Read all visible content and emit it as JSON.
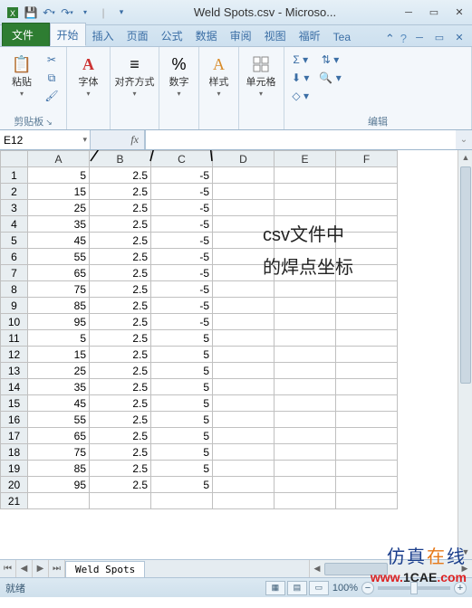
{
  "titlebar": {
    "title": "Weld Spots.csv - Microso..."
  },
  "tabs": {
    "file": "文件",
    "home": "开始",
    "insert": "插入",
    "page": "页面",
    "formula": "公式",
    "data": "数据",
    "review": "审阅",
    "view": "视图",
    "foxit": "福昕",
    "team": "Tea"
  },
  "ribbon": {
    "paste": "粘贴",
    "font": "字体",
    "align": "对齐方式",
    "number": "数字",
    "styles": "样式",
    "cells": "单元格",
    "clipboard_grp": "剪贴板",
    "editing_grp": "编辑"
  },
  "formula_bar": {
    "name_box": "E12",
    "fx": "fx",
    "formula": ""
  },
  "annotations": {
    "x": "X",
    "y": "Y",
    "z": "Z",
    "note_line1": "csv文件中",
    "note_line2": "的焊点坐标"
  },
  "columns": [
    "A",
    "B",
    "C",
    "D",
    "E",
    "F"
  ],
  "rows_header": [
    "1",
    "2",
    "3",
    "4",
    "5",
    "6",
    "7",
    "8",
    "9",
    "10",
    "11",
    "12",
    "13",
    "14",
    "15",
    "16",
    "17",
    "18",
    "19",
    "20",
    "21"
  ],
  "chart_data": {
    "type": "table",
    "columns": [
      "A",
      "B",
      "C"
    ],
    "rows": [
      [
        "5",
        "2.5",
        "-5"
      ],
      [
        "15",
        "2.5",
        "-5"
      ],
      [
        "25",
        "2.5",
        "-5"
      ],
      [
        "35",
        "2.5",
        "-5"
      ],
      [
        "45",
        "2.5",
        "-5"
      ],
      [
        "55",
        "2.5",
        "-5"
      ],
      [
        "65",
        "2.5",
        "-5"
      ],
      [
        "75",
        "2.5",
        "-5"
      ],
      [
        "85",
        "2.5",
        "-5"
      ],
      [
        "95",
        "2.5",
        "-5"
      ],
      [
        "5",
        "2.5",
        "5"
      ],
      [
        "15",
        "2.5",
        "5"
      ],
      [
        "25",
        "2.5",
        "5"
      ],
      [
        "35",
        "2.5",
        "5"
      ],
      [
        "45",
        "2.5",
        "5"
      ],
      [
        "55",
        "2.5",
        "5"
      ],
      [
        "65",
        "2.5",
        "5"
      ],
      [
        "75",
        "2.5",
        "5"
      ],
      [
        "85",
        "2.5",
        "5"
      ],
      [
        "95",
        "2.5",
        "5"
      ],
      [
        "",
        "",
        ""
      ]
    ]
  },
  "sheet": {
    "name": "Weld Spots"
  },
  "status": {
    "ready": "就绪",
    "zoom": "100%"
  },
  "watermark": {
    "line1_a": "仿",
    "line1_b": "真",
    "line1_c": "在",
    "line1_d": "线",
    "line2": "www.1CAE.com"
  }
}
